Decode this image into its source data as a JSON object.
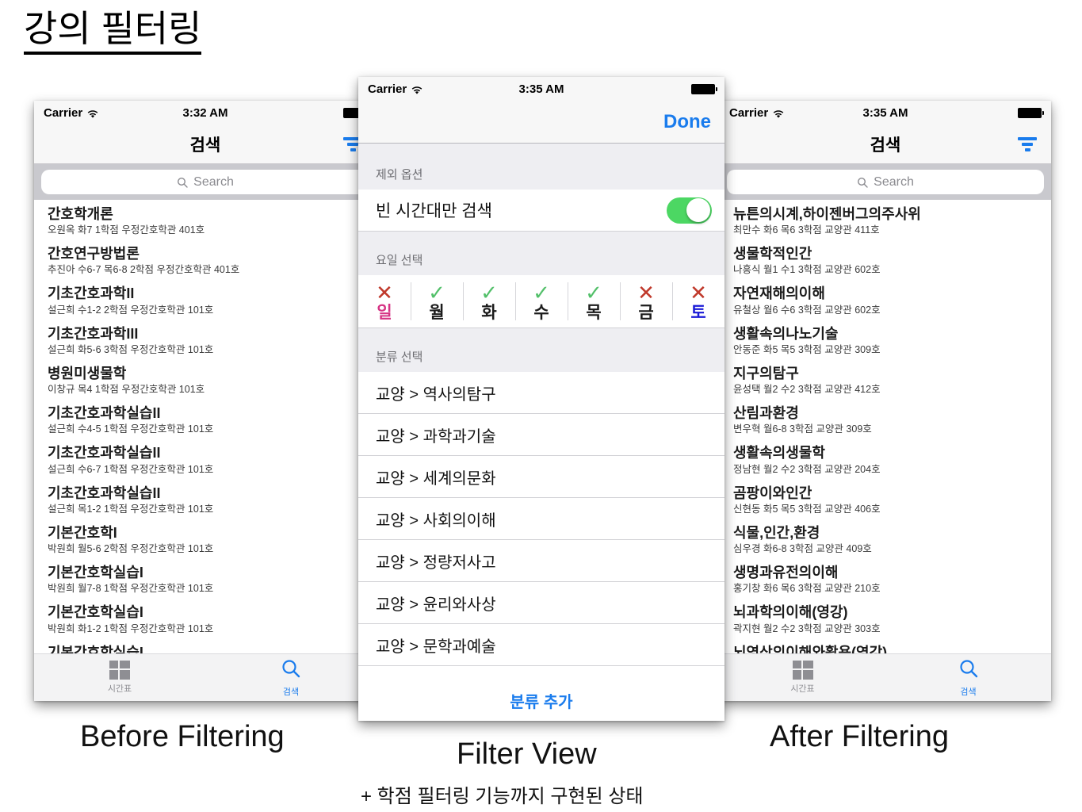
{
  "slide": {
    "title": "강의 필터링",
    "captions": {
      "before": "Before Filtering",
      "filter": "Filter View",
      "after": "After Filtering",
      "sub": "+ 학점 필터링 기능까지 구현된 상태"
    }
  },
  "colors": {
    "accent_blue": "#1a7ced",
    "switch_green": "#4cd763",
    "check_green": "#53c06a",
    "cross_red": "#c0392b",
    "sunday_pink": "#d63384",
    "saturday_blue": "#1a1ad6",
    "searchbar_bg": "#c9c9ce",
    "group_header_bg": "#eeeef2"
  },
  "before_phone": {
    "statusbar": {
      "carrier": "Carrier",
      "wifi_icon": "wifi-icon",
      "time": "3:32 AM",
      "battery_icon": "battery-full-icon"
    },
    "navbar": {
      "title": "검색",
      "filter_icon": "filter-icon"
    },
    "search": {
      "placeholder": "Search",
      "icon": "search-icon"
    },
    "courses": [
      {
        "title": "간호학개론",
        "meta": "오원옥  화7  1학점  우정간호학관 401호"
      },
      {
        "title": "간호연구방법론",
        "meta": "추진아  수6-7 목6-8  2학점  우정간호학관 401호"
      },
      {
        "title": "기초간호과학II",
        "meta": "설근희  수1-2  2학점  우정간호학관 101호"
      },
      {
        "title": "기초간호과학III",
        "meta": "설근희  화5-6  3학점  우정간호학관 101호"
      },
      {
        "title": "병원미생물학",
        "meta": "이창규  목4  1학점  우정간호학관 101호"
      },
      {
        "title": "기초간호과학실습II",
        "meta": "설근희  수4-5  1학점  우정간호학관 101호"
      },
      {
        "title": "기초간호과학실습II",
        "meta": "설근희  수6-7  1학점  우정간호학관 101호"
      },
      {
        "title": "기초간호과학실습II",
        "meta": "설근희  목1-2  1학점  우정간호학관 101호"
      },
      {
        "title": "기본간호학I",
        "meta": "박원희  월5-6  2학점  우정간호학관 101호"
      },
      {
        "title": "기본간호학실습I",
        "meta": "박원희  월7-8  1학점  우정간호학관 101호"
      },
      {
        "title": "기본간호학실습I",
        "meta": "박원희  화1-2  1학점  우정간호학관 101호"
      },
      {
        "title": "기본간호학실습I",
        "meta": ""
      }
    ],
    "tabs": [
      {
        "label": "시간표",
        "icon": "grid-icon",
        "active": false
      },
      {
        "label": "검색",
        "icon": "search-icon",
        "active": true
      }
    ]
  },
  "filter_phone": {
    "statusbar": {
      "carrier": "Carrier",
      "wifi_icon": "wifi-icon",
      "time": "3:35 AM",
      "battery_icon": "battery-full-icon"
    },
    "done_label": "Done",
    "exclude_section": {
      "header": "제외 옵션",
      "toggle_label": "빈 시간대만 검색",
      "toggle_on": true
    },
    "day_section": {
      "header": "요일 선택",
      "days": [
        {
          "name": "일",
          "selected": false,
          "mark": "✕",
          "color_key": "sunday"
        },
        {
          "name": "월",
          "selected": true,
          "mark": "✓",
          "color_key": "normal"
        },
        {
          "name": "화",
          "selected": true,
          "mark": "✓",
          "color_key": "normal"
        },
        {
          "name": "수",
          "selected": true,
          "mark": "✓",
          "color_key": "normal"
        },
        {
          "name": "목",
          "selected": true,
          "mark": "✓",
          "color_key": "normal"
        },
        {
          "name": "금",
          "selected": false,
          "mark": "✕",
          "color_key": "normal"
        },
        {
          "name": "토",
          "selected": false,
          "mark": "✕",
          "color_key": "saturday"
        }
      ]
    },
    "category_section": {
      "header": "분류 선택",
      "items": [
        "교양 > 역사의탐구",
        "교양 > 과학과기술",
        "교양 > 세계의문화",
        "교양 > 사회의이해",
        "교양 > 정량저사고",
        "교양 > 윤리와사상",
        "교양 > 문학과예술"
      ],
      "add_label": "분류 추가"
    }
  },
  "after_phone": {
    "statusbar": {
      "carrier": "Carrier",
      "wifi_icon": "wifi-icon",
      "time": "3:35 AM",
      "battery_icon": "battery-full-icon"
    },
    "navbar": {
      "title": "검색",
      "filter_icon": "filter-icon"
    },
    "search": {
      "placeholder": "Search",
      "icon": "search-icon"
    },
    "courses": [
      {
        "title": "뉴튼의시계,하이젠버그의주사위",
        "meta": "최만수  화6 목6  3학점  교양관 411호"
      },
      {
        "title": "생물학적인간",
        "meta": "나흥식  월1 수1  3학점  교양관 602호"
      },
      {
        "title": "자연재해의이해",
        "meta": "유철상  월6 수6  3학점  교양관 602호"
      },
      {
        "title": "생활속의나노기술",
        "meta": "안동준  화5 목5  3학점  교양관 309호"
      },
      {
        "title": "지구의탐구",
        "meta": "윤성택  월2 수2  3학점  교양관 412호"
      },
      {
        "title": "산림과환경",
        "meta": "변우혁  월6-8  3학점  교양관 309호"
      },
      {
        "title": "생활속의생물학",
        "meta": "정남현  월2 수2  3학점  교양관 204호"
      },
      {
        "title": "곰팡이와인간",
        "meta": "신현동  화5 목5  3학점  교양관 406호"
      },
      {
        "title": "식물,인간,환경",
        "meta": "심우경  화6-8  3학점  교양관 409호"
      },
      {
        "title": "생명과유전의이해",
        "meta": "홍기창  화6 목6  3학점  교양관 210호"
      },
      {
        "title": "뇌과학의이해(영강)",
        "meta": "곽지현  월2 수2  3학점  교양관 303호"
      },
      {
        "title": "뇌영상의이해와활용(영강)",
        "meta": ""
      }
    ],
    "tabs": [
      {
        "label": "시간표",
        "icon": "grid-icon",
        "active": false
      },
      {
        "label": "검색",
        "icon": "search-icon",
        "active": true
      }
    ]
  }
}
